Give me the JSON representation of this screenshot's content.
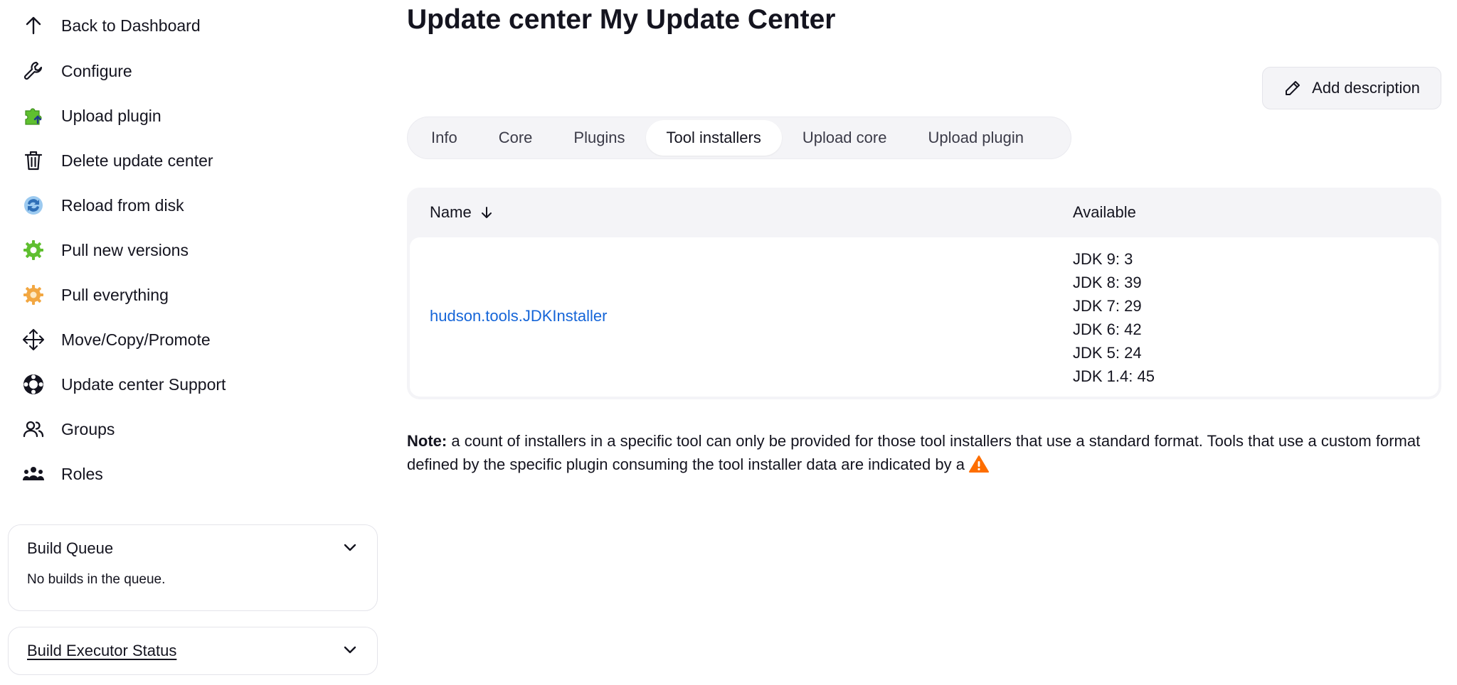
{
  "sidebar": {
    "tasks": [
      {
        "label": "Back to Dashboard",
        "icon": "arrow-up-icon"
      },
      {
        "label": "Configure",
        "icon": "wrench-icon"
      },
      {
        "label": "Upload plugin",
        "icon": "puzzle-plugin-icon"
      },
      {
        "label": "Delete update center",
        "icon": "trash-icon"
      },
      {
        "label": "Reload from disk",
        "icon": "reload-icon"
      },
      {
        "label": "Pull new versions",
        "icon": "green-gear-icon"
      },
      {
        "label": "Pull everything",
        "icon": "orange-gear-icon"
      },
      {
        "label": "Move/Copy/Promote",
        "icon": "move-arrows-icon"
      },
      {
        "label": "Update center Support",
        "icon": "lifebuoy-icon"
      },
      {
        "label": "Groups",
        "icon": "groups-icon"
      },
      {
        "label": "Roles",
        "icon": "roles-icon"
      }
    ],
    "build_queue": {
      "title": "Build Queue",
      "empty_text": "No builds in the queue."
    },
    "build_executor": {
      "title": "Build Executor Status"
    }
  },
  "main": {
    "title": "Update center My Update Center",
    "add_description": "Add description",
    "tabs": [
      {
        "label": "Info",
        "active": false
      },
      {
        "label": "Core",
        "active": false
      },
      {
        "label": "Plugins",
        "active": false
      },
      {
        "label": "Tool installers",
        "active": true
      },
      {
        "label": "Upload core",
        "active": false
      },
      {
        "label": "Upload plugin",
        "active": false
      }
    ],
    "table": {
      "columns": [
        "Name",
        "Available"
      ],
      "rows": [
        {
          "name": "hudson.tools.JDKInstaller",
          "available": [
            "JDK 9: 3",
            "JDK 8: 39",
            "JDK 7: 29",
            "JDK 6: 42",
            "JDK 5: 24",
            "JDK 1.4: 45"
          ]
        }
      ]
    },
    "note": {
      "label": "Note:",
      "text": "a count of installers in a specific tool can only be provided for those tool installers that use a standard format. Tools that use a custom format defined by the specific plugin consuming the tool installer data are indicated by a"
    }
  },
  "colors": {
    "link": "#1565d8",
    "warning": "#fe6e00",
    "green": "#5fbf2f",
    "orange": "#f2a742"
  }
}
